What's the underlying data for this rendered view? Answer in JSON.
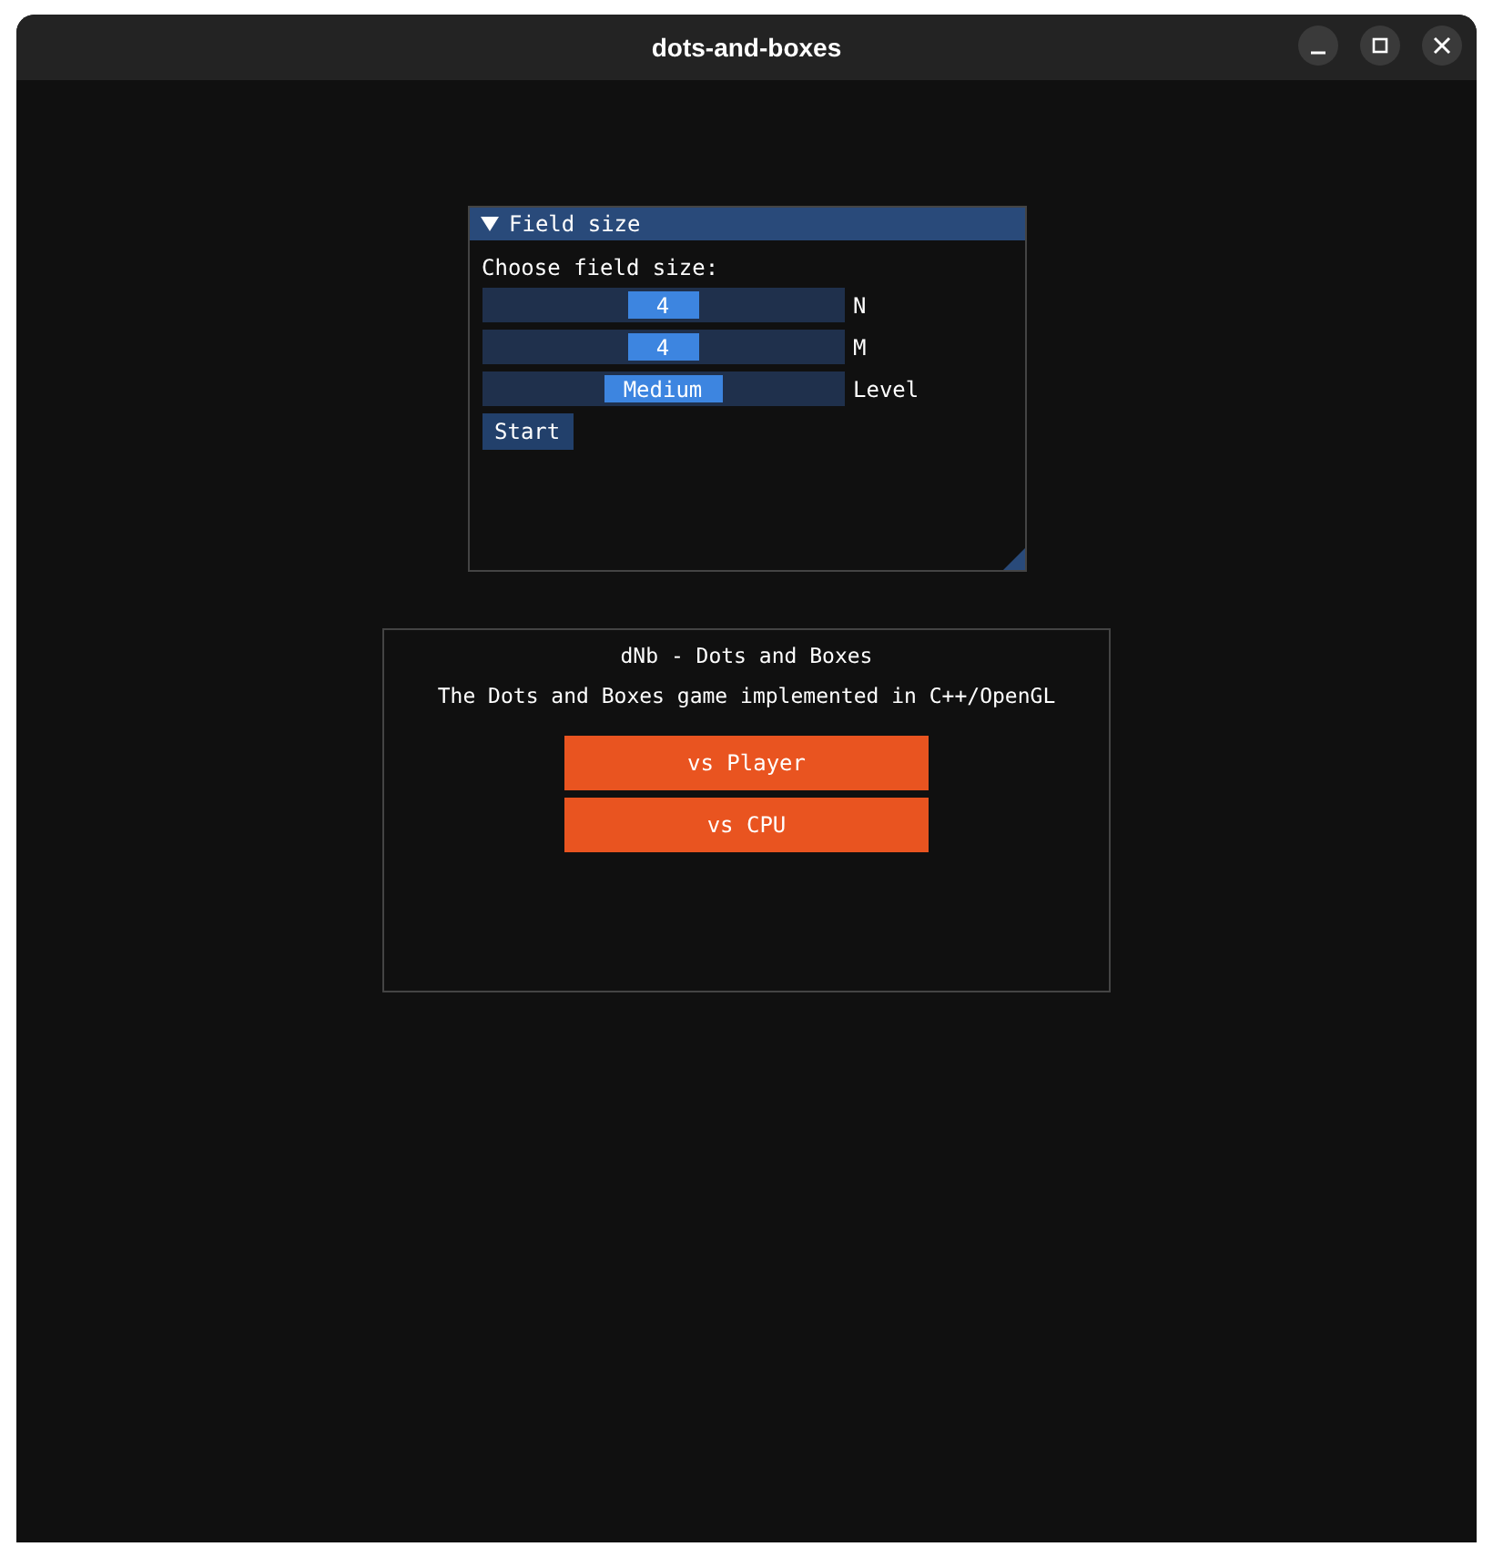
{
  "window": {
    "title": "dots-and-boxes"
  },
  "settings_panel": {
    "title": "Field size",
    "expanded": true,
    "prompt": "Choose field size:",
    "sliders": [
      {
        "value": "4",
        "label": "N",
        "level": 0.5
      },
      {
        "value": "4",
        "label": "M",
        "level": 0.5
      },
      {
        "value": "Medium",
        "label": "Level",
        "level": 0.5
      }
    ],
    "start_button": "Start"
  },
  "menu_panel": {
    "title": "dNb - Dots and Boxes",
    "subtitle": "The Dots and Boxes game implemented in C++/OpenGL",
    "buttons": [
      "vs Player",
      "vs CPU"
    ]
  }
}
